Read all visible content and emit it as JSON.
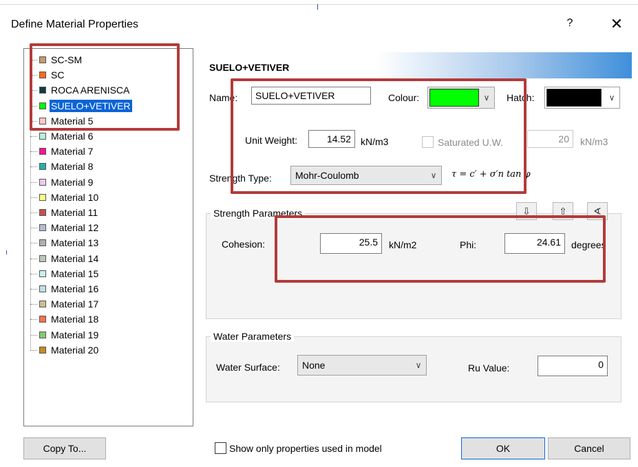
{
  "window": {
    "title": "Define Material Properties",
    "help": "?",
    "close": "✕"
  },
  "materials": [
    {
      "label": "SC-SM",
      "color": "#c79a6b"
    },
    {
      "label": "SC",
      "color": "#ff6a1a"
    },
    {
      "label": "ROCA ARENISCA",
      "color": "#0d3f3f"
    },
    {
      "label": "SUELO+VETIVER",
      "color": "#00ff00",
      "selected": true
    },
    {
      "label": "Material 5",
      "color": "#ffc8c8"
    },
    {
      "label": "Material 6",
      "color": "#b4f0dc"
    },
    {
      "label": "Material 7",
      "color": "#ff1493"
    },
    {
      "label": "Material 8",
      "color": "#20b2aa"
    },
    {
      "label": "Material 9",
      "color": "#f0c8f0"
    },
    {
      "label": "Material 10",
      "color": "#ffff80"
    },
    {
      "label": "Material 11",
      "color": "#c85050"
    },
    {
      "label": "Material 12",
      "color": "#b4bcd0"
    },
    {
      "label": "Material 13",
      "color": "#b0b0b0"
    },
    {
      "label": "Material 14",
      "color": "#b8c8b8"
    },
    {
      "label": "Material 15",
      "color": "#c8f0f0"
    },
    {
      "label": "Material 16",
      "color": "#c0e0e8"
    },
    {
      "label": "Material 17",
      "color": "#c8c090"
    },
    {
      "label": "Material 18",
      "color": "#ff7050"
    },
    {
      "label": "Material 19",
      "color": "#88c870"
    },
    {
      "label": "Material 20",
      "color": "#c88a20"
    }
  ],
  "header": {
    "title": "SUELO+VETIVER"
  },
  "props": {
    "name_label": "Name:",
    "name_value": "SUELO+VETIVER",
    "colour_label": "Colour:",
    "colour_value": "#00ff00",
    "hatch_label": "Hatch:",
    "unit_weight_label": "Unit Weight:",
    "unit_weight_value": "14.52",
    "unit_weight_unit": "kN/m3",
    "saturated_label": "Saturated U.W.",
    "saturated_value": "20",
    "saturated_unit": "kN/m3",
    "strength_type_label": "Strength Type:",
    "strength_type_value": "Mohr-Coulomb",
    "formula": "τ = c′ + σ′n tan φ"
  },
  "strength": {
    "group_title": "Strength Parameters",
    "cohesion_label": "Cohesion:",
    "cohesion_value": "25.5",
    "cohesion_unit": "kN/m2",
    "phi_label": "Phi:",
    "phi_value": "24.61",
    "phi_unit": "degrees"
  },
  "water": {
    "group_title": "Water Parameters",
    "surface_label": "Water Surface:",
    "surface_value": "None",
    "ru_label": "Ru Value:",
    "ru_value": "0"
  },
  "footer": {
    "copy_to": "Copy To...",
    "show_only": "Show only properties used in model",
    "ok": "OK",
    "cancel": "Cancel"
  }
}
